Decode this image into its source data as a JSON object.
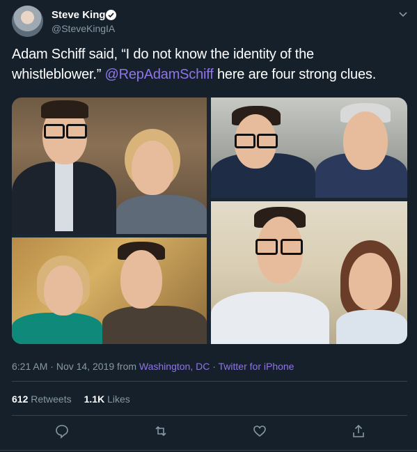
{
  "author": {
    "name": "Steve King",
    "handle": "@SteveKingIA"
  },
  "tweet": {
    "text_before": "Adam Schiff said, “I do not know the identity of the whistleblower.” ",
    "mention": "@RepAdamSchiff",
    "text_after": " here are four strong clues."
  },
  "meta": {
    "time": "6:21 AM",
    "sep1": " · ",
    "date": "Nov 14, 2019",
    "from": " from ",
    "location": "Washington, DC",
    "sep2": " · ",
    "source": "Twitter for iPhone"
  },
  "stats": {
    "retweets_count": "612",
    "retweets_label": " Retweets",
    "likes_count": "1.1K",
    "likes_label": " Likes"
  },
  "icons": {
    "verified": "verified-badge-icon",
    "more": "chevron-down-icon",
    "reply": "reply-icon",
    "retweet": "retweet-icon",
    "like": "heart-icon",
    "share": "share-icon"
  },
  "colors": {
    "background": "#15202b",
    "link": "#8f75e6",
    "muted": "#8899a6"
  }
}
